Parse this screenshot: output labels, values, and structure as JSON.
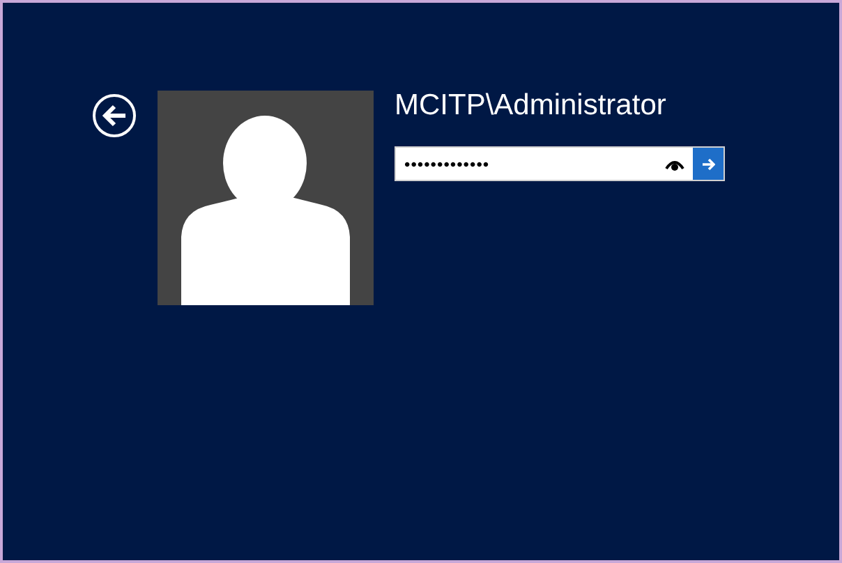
{
  "user": {
    "name": "MCITP\\Administrator"
  },
  "password": {
    "value": "•••••••••••••"
  }
}
